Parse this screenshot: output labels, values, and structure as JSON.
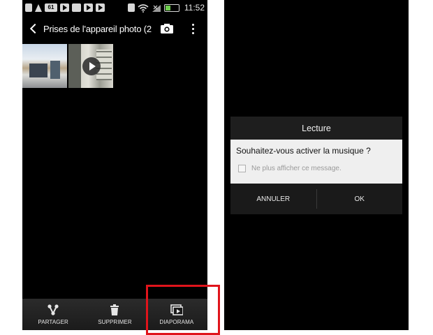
{
  "left_screen": {
    "status_bar": {
      "notification_badge": "61",
      "time": "11:52",
      "battery_level": 0.35,
      "icons": [
        "back-arrow-notification-icon",
        "navigation-icon",
        "badge-61-icon",
        "play-store-icon",
        "video-icon",
        "play-store-icon",
        "play-store-icon",
        "vibrate-icon",
        "wifi-icon",
        "signal-icon",
        "battery-icon"
      ]
    },
    "title_bar": {
      "title": "Prises de l'appareil photo (2",
      "back_icon": "chevron-left-icon",
      "camera_icon": "camera-icon",
      "menu_icon": "more-vertical-icon"
    },
    "thumbnails": [
      {
        "kind": "photo"
      },
      {
        "kind": "video",
        "overlay_icon": "play-icon"
      }
    ],
    "bottom_bar": {
      "buttons": [
        {
          "label": "PARTAGER",
          "icon": "share-icon"
        },
        {
          "label": "SUPPRIMER",
          "icon": "trash-icon"
        },
        {
          "label": "DIAPORAMA",
          "icon": "slideshow-icon"
        }
      ],
      "highlighted": "DIAPORAMA"
    }
  },
  "right_screen": {
    "dialog": {
      "title": "Lecture",
      "question": "Souhaitez-vous activer la musique ?",
      "checkbox_label": "Ne plus afficher ce message.",
      "checkbox_checked": false,
      "cancel_label": "ANNULER",
      "ok_label": "OK"
    }
  },
  "colors": {
    "highlight": "#e0141b",
    "background": "#000000",
    "dialog_body": "#efefef"
  }
}
